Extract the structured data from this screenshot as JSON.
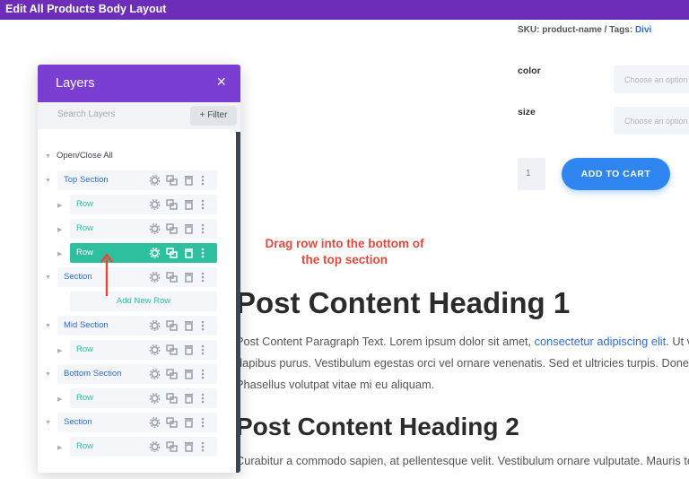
{
  "window": {
    "title": "Edit All Products Body Layout"
  },
  "product": {
    "sku_text": "SKU: product-name / Tags:",
    "tag": "Divi",
    "attributes": [
      {
        "label": "color",
        "placeholder": "Choose an option"
      },
      {
        "label": "size",
        "placeholder": "Choose an option"
      }
    ],
    "quantity": "1",
    "add_to_cart": "ADD TO CART"
  },
  "annotation": {
    "line1": "Drag row into the bottom of",
    "line2": "the top section"
  },
  "content": {
    "heading1": "Post Content Heading 1",
    "para1_line1_a": "Post Content Paragraph Text. Lorem ipsum dolor sit amet,",
    "para1_link": "consectetur adipiscing elit",
    "para1_line1_b": ". Ut vitae",
    "para1_line2": "dapibus purus. Vestibulum egestas orci vel ornare venenatis. Sed et ultricies turpis. Donec",
    "para1_line3": "Phasellus volutpat vitae mi eu aliquam.",
    "heading2": "Post Content Heading 2",
    "para2_line1": "Curabitur a commodo sapien, at pellentesque velit. Vestibulum ornare vulputate. Mauris tempor"
  },
  "layers_panel": {
    "title": "Layers",
    "close_icon": "×",
    "search_placeholder": "Search Layers",
    "filter_label": "+ Filter",
    "open_close_all": "Open/Close All",
    "add_new_row": "Add New Row",
    "items": [
      {
        "type": "section",
        "label": "Top Section"
      },
      {
        "type": "row",
        "label": "Row"
      },
      {
        "type": "row",
        "label": "Row"
      },
      {
        "type": "row-active",
        "label": "Row"
      },
      {
        "type": "section",
        "label": "Section"
      },
      {
        "type": "section",
        "label": "Mid Section"
      },
      {
        "type": "row",
        "label": "Row"
      },
      {
        "type": "section",
        "label": "Bottom Section"
      },
      {
        "type": "row",
        "label": "Row"
      },
      {
        "type": "section",
        "label": "Section"
      },
      {
        "type": "row",
        "label": "Row"
      }
    ]
  },
  "colors": {
    "brand_purple": "#7b3ed2",
    "row_green": "#2dbf9e",
    "section_blue": "#2e6bd8",
    "annotation_red": "#e8483a",
    "button_blue": "#2f86f0"
  }
}
